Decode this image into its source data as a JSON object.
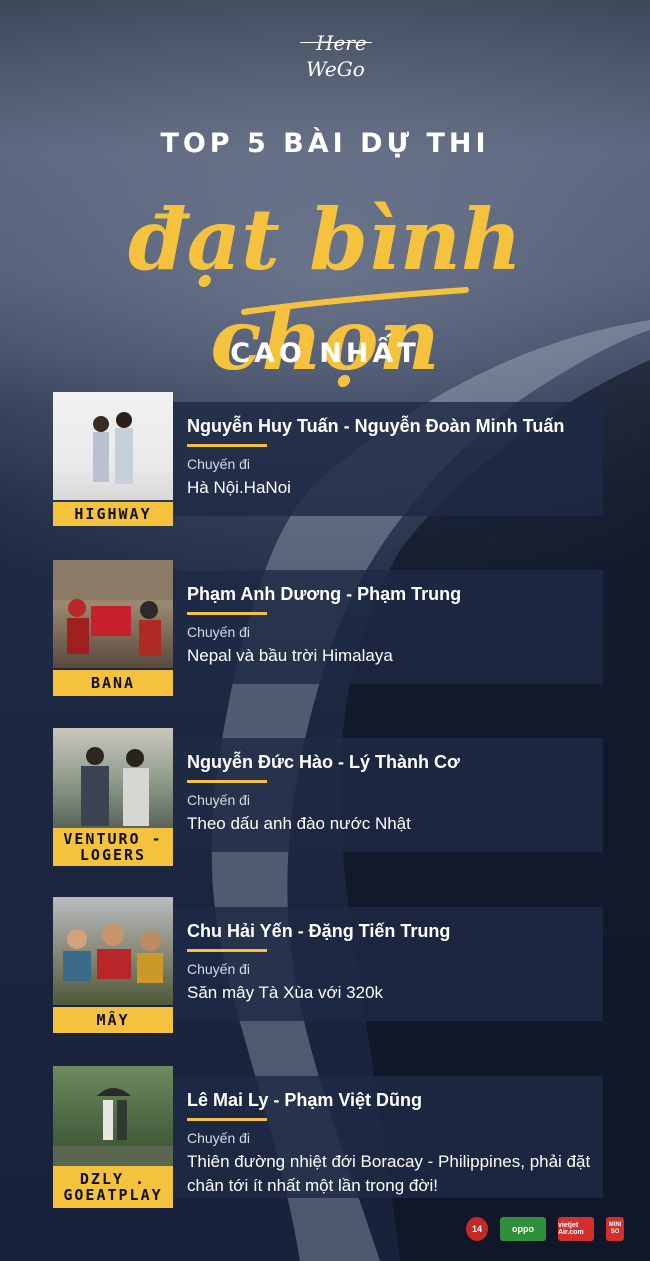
{
  "logo": {
    "line1": "Here",
    "line2": "WeGo"
  },
  "heading": {
    "line1": "TOP 5 BÀI DỰ THI",
    "line2": "đạt bình chọn",
    "line3": "CAO NHẤT"
  },
  "trip_label": "Chuyến đi",
  "entries": [
    {
      "team": "HIGHWAY",
      "names": "Nguyễn Huy Tuấn - Nguyễn Đoàn Minh Tuấn",
      "trip": "Hà Nội.HaNoi"
    },
    {
      "team": "BANA",
      "names": "Phạm Anh Dương - Phạm Trung",
      "trip": "Nepal và bầu trời Himalaya"
    },
    {
      "team": "VENTURO - LOGERS",
      "names": "Nguyễn Đức Hào - Lý Thành Cơ",
      "trip": "Theo dấu anh đào nước Nhật"
    },
    {
      "team": "MÂY",
      "names": "Chu Hải Yến - Đặng Tiến Trung",
      "trip": "Săn mây Tà Xùa với 320k"
    },
    {
      "team": "DZLY . GOEATPLAY",
      "names": "Lê Mai Ly - Phạm Việt Dũng",
      "trip": "Thiên đường nhiệt đới Boracay - Philippines, phải đặt chân tới ít nhất một lần trong đời!"
    }
  ],
  "sponsors": [
    "14",
    "oppo",
    "vietjet Air.com",
    "MINI SO"
  ],
  "colors": {
    "accent": "#f4c23d",
    "panel": "#1e2a46"
  }
}
